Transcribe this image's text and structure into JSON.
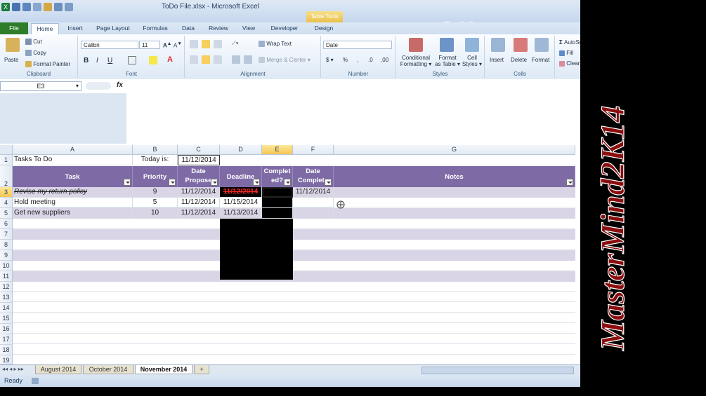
{
  "window": {
    "title": "ToDo File.xlsx - Microsoft Excel",
    "context_tab": "Table Tools",
    "clock_overlay": "5:03"
  },
  "ribbon_tabs": [
    "File",
    "Home",
    "Insert",
    "Page Layout",
    "Formulas",
    "Data",
    "Review",
    "View",
    "Developer",
    "Design"
  ],
  "clipboard": {
    "paste": "Paste",
    "cut": "Cut",
    "copy": "Copy",
    "format_painter": "Format Painter",
    "label": "Clipboard"
  },
  "font": {
    "name": "Calibri",
    "size": "11",
    "label": "Font"
  },
  "alignment": {
    "wrap": "Wrap Text",
    "merge": "Merge & Center",
    "label": "Alignment"
  },
  "number": {
    "format": "Date",
    "label": "Number"
  },
  "styles": {
    "conditional": "Conditional Formatting",
    "cond1": "Conditional",
    "cond2": "Formatting",
    "format_table1": "Format",
    "format_table2": "as Table",
    "cell1": "Cell",
    "cell2": "Styles",
    "label": "Styles"
  },
  "cells": {
    "insert": "Insert",
    "delete": "Delete",
    "format": "Format",
    "label": "Cells"
  },
  "editing": {
    "autosum": "AutoSum",
    "fill": "Fill",
    "clear": "Clear"
  },
  "formula_bar": {
    "name_box": "E3",
    "fx": "fx",
    "formula": ""
  },
  "columns": [
    "A",
    "B",
    "C",
    "D",
    "E",
    "F",
    "G"
  ],
  "rows": [
    "1",
    "2",
    "3",
    "4",
    "5",
    "6",
    "7",
    "8",
    "9",
    "10",
    "11",
    "12",
    "13",
    "14",
    "15",
    "16",
    "17",
    "18",
    "19"
  ],
  "sheet": {
    "a1": "Tasks To Do",
    "b1": "Today is:",
    "c1": "11/12/2014",
    "headers": {
      "task": "Task",
      "priority": "Priority",
      "date1": "Date",
      "date2": "Propose",
      "deadline": "Deadline",
      "comp1": "Complet",
      "comp2": "ed?",
      "dc1": "Date",
      "dc2": "Complete",
      "notes": "Notes"
    },
    "data": [
      {
        "task": "Revise my return policy",
        "priority": "9",
        "proposed": "11/12/2014",
        "deadline": "11/12/2014",
        "completed": "",
        "date_completed": "11/12/2014"
      },
      {
        "task": "Hold meeting",
        "priority": "5",
        "proposed": "11/12/2014",
        "deadline": "11/15/2014",
        "completed": "",
        "date_completed": ""
      },
      {
        "task": "Get new suppliers",
        "priority": "10",
        "proposed": "11/12/2014",
        "deadline": "11/13/2014",
        "completed": "",
        "date_completed": ""
      }
    ]
  },
  "sheet_tabs": [
    "August 2014",
    "October 2014",
    "November 2014"
  ],
  "status": {
    "text": "Ready"
  },
  "watermark": "MasterMind2K14",
  "colors": {
    "header_purple": "#7e6ba6",
    "band": "#d9d4e6",
    "overdue_red": "#ff2a2a",
    "file_green": "#2d7d2a"
  }
}
